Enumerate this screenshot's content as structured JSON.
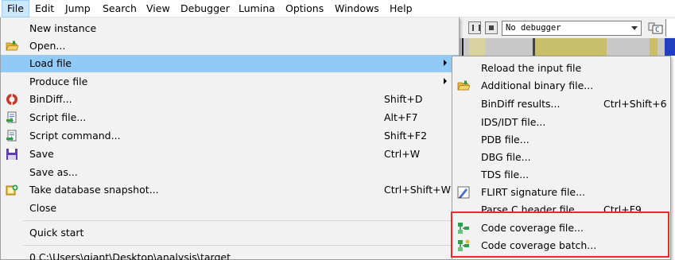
{
  "menubar": {
    "items": [
      "File",
      "Edit",
      "Jump",
      "Search",
      "View",
      "Debugger",
      "Lumina",
      "Options",
      "Windows",
      "Help"
    ]
  },
  "toolbar": {
    "debugger_select": "No debugger",
    "icon_c_text": "C"
  },
  "file_menu": {
    "items": [
      {
        "label": "New instance",
        "shortcut": "",
        "icon": "none"
      },
      {
        "label": "Open...",
        "shortcut": "",
        "icon": "open-folder-icon"
      },
      {
        "label": "Load file",
        "shortcut": "",
        "icon": "none",
        "submenu": true,
        "highlighted": true
      },
      {
        "label": "Produce file",
        "shortcut": "",
        "icon": "none",
        "submenu": true
      },
      {
        "label": "BinDiff...",
        "shortcut": "Shift+D",
        "icon": "bindiff-icon"
      },
      {
        "label": "Script file...",
        "shortcut": "Alt+F7",
        "icon": "script-file-icon"
      },
      {
        "label": "Script command...",
        "shortcut": "Shift+F2",
        "icon": "script-command-icon"
      },
      {
        "label": "Save",
        "shortcut": "Ctrl+W",
        "icon": "save-icon"
      },
      {
        "label": "Save as...",
        "shortcut": "",
        "icon": "none"
      },
      {
        "label": "Take database snapshot...",
        "shortcut": "Ctrl+Shift+W",
        "icon": "snapshot-icon"
      },
      {
        "label": "Close",
        "shortcut": "",
        "icon": "none"
      },
      {
        "label": "Quick start",
        "shortcut": "",
        "icon": "none"
      },
      {
        "label": "0  C:\\Users\\giant\\Desktop\\analysis\\target",
        "shortcut": "",
        "icon": "none"
      }
    ]
  },
  "load_file_submenu": {
    "items": [
      {
        "label": "Reload the input file",
        "shortcut": "",
        "icon": "none"
      },
      {
        "label": "Additional binary file...",
        "shortcut": "",
        "icon": "open-folder-icon"
      },
      {
        "label": "BinDiff results...",
        "shortcut": "Ctrl+Shift+6",
        "icon": "none"
      },
      {
        "label": "IDS/IDT file...",
        "shortcut": "",
        "icon": "none"
      },
      {
        "label": "PDB file...",
        "shortcut": "",
        "icon": "none"
      },
      {
        "label": "DBG file...",
        "shortcut": "",
        "icon": "none"
      },
      {
        "label": "TDS file...",
        "shortcut": "",
        "icon": "none"
      },
      {
        "label": "FLIRT signature file...",
        "shortcut": "",
        "icon": "flirt-signature-icon"
      },
      {
        "label": "Parse C header file...",
        "shortcut": "Ctrl+F9",
        "icon": "none"
      },
      {
        "label": "Code coverage file...",
        "shortcut": "",
        "icon": "code-coverage-icon"
      },
      {
        "label": "Code coverage batch...",
        "shortcut": "",
        "icon": "code-coverage-batch-icon"
      }
    ]
  },
  "colors": {
    "menu_highlight": "#91c9f7",
    "menubar_active": "#cce8ff",
    "annotation_red": "#e52b2b"
  }
}
